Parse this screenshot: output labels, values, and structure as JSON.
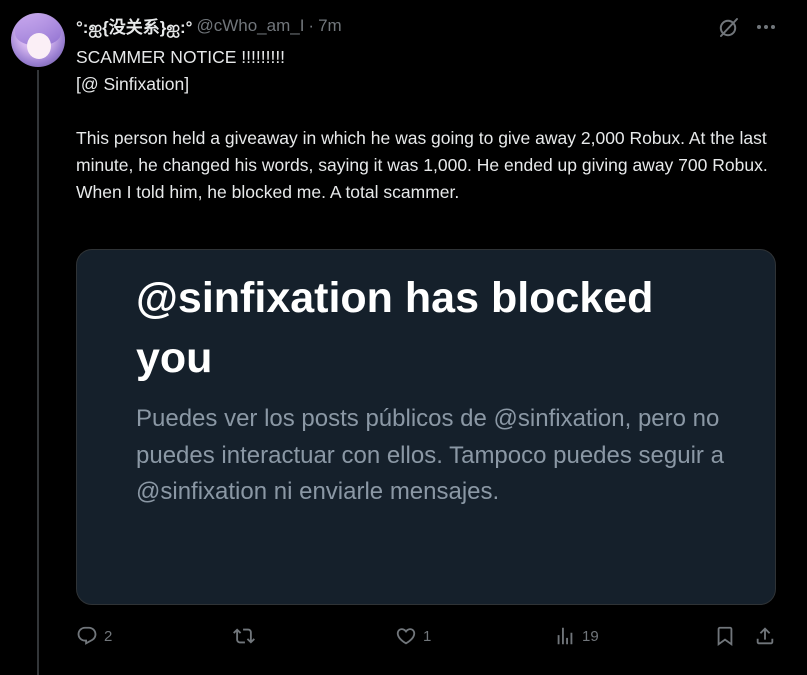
{
  "post": {
    "author": {
      "display_name": "°:ஐ{没关系}ஐ:°",
      "handle": "@cWho_am_I",
      "separator": "·",
      "time": "7m"
    },
    "text": {
      "line1": "SCAMMER NOTICE !!!!!!!!!",
      "line2": "[@ Sinfixation]",
      "paragraph": "This person held a giveaway in which he was going to give away 2,000 Robux. At the last minute, he changed his words, saying it was 1,000. He ended up giving away 700 Robux. When I told him, he blocked me. A total scammer."
    },
    "card": {
      "title": "@sinfixation has blocked you",
      "body": "Puedes ver los posts públicos de @sinfixation, pero no puedes interactuar con ellos. Tampoco puedes seguir a @sinfixation ni enviarle mensajes."
    },
    "actions": {
      "replies": "2",
      "reposts": "",
      "likes": "1",
      "views": "19"
    },
    "icons": [
      "grok-icon",
      "more-icon",
      "reply-icon",
      "repost-icon",
      "like-icon",
      "views-icon",
      "bookmark-icon",
      "share-icon"
    ]
  },
  "colors": {
    "background": "#000000",
    "text": "#e7e9ea",
    "secondary_text": "#71767b",
    "card_background": "#15202b",
    "card_body_text": "#8b98a5",
    "divider": "#333639"
  }
}
